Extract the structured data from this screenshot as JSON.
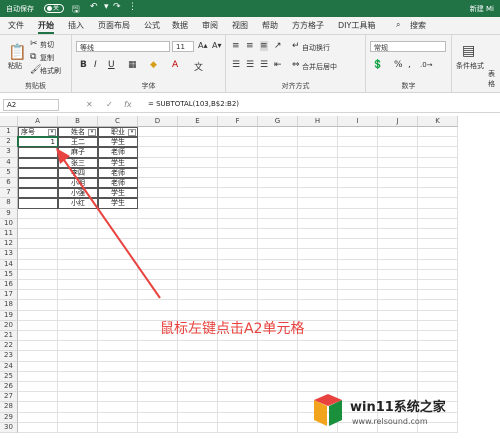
{
  "titlebar": {
    "autosave": "自动保存",
    "toggle": "关",
    "new_label": "新建 Mi"
  },
  "tabs": [
    "文件",
    "开始",
    "插入",
    "页面布局",
    "公式",
    "数据",
    "审阅",
    "视图",
    "帮助",
    "方方格子",
    "DIY工具箱"
  ],
  "search": "搜索",
  "ribbon": {
    "clipboard": {
      "paste": "粘贴",
      "cut": "剪切",
      "copy": "复制",
      "format_painter": "格式刷",
      "label": "剪贴板"
    },
    "font": {
      "name": "等线",
      "size": "11",
      "label": "字体",
      "bold": "B",
      "italic": "I",
      "underline": "U"
    },
    "alignment": {
      "wrap": "自动换行",
      "merge": "合并后居中",
      "label": "对齐方式"
    },
    "number": {
      "format": "常规",
      "label": "数字",
      "percent": "%",
      "comma": ","
    },
    "styles": {
      "conditional": "条件格式",
      "table": "表格"
    }
  },
  "formula_bar": {
    "namebox": "A2",
    "formula": "= SUBTOTAL(103,B$2:B2)",
    "fx": "fx"
  },
  "columns": [
    "A",
    "B",
    "C",
    "D",
    "E",
    "F",
    "G",
    "H",
    "I",
    "J",
    "K"
  ],
  "rows": [
    "1",
    "2",
    "3",
    "4",
    "5",
    "6",
    "7",
    "8",
    "9",
    "10",
    "11",
    "12",
    "13",
    "14",
    "15",
    "16",
    "17",
    "18",
    "19",
    "20",
    "21",
    "22",
    "23",
    "24",
    "25",
    "26",
    "27",
    "28",
    "29",
    "30"
  ],
  "table": {
    "headers": [
      "序号",
      "姓名",
      "职业"
    ],
    "a2": "1",
    "names": [
      "王二",
      "麻子",
      "张三",
      "李四",
      "小明",
      "小强",
      "小红"
    ],
    "jobs": [
      "学生",
      "老师",
      "学生",
      "老师",
      "老师",
      "学生",
      "学生"
    ]
  },
  "annotation": "鼠标左键点击A2单元格",
  "watermark": {
    "title": "win11系统之家",
    "url": "www.relsound.com"
  },
  "colors": {
    "accent": "#217346",
    "arrow": "#e8433e"
  }
}
